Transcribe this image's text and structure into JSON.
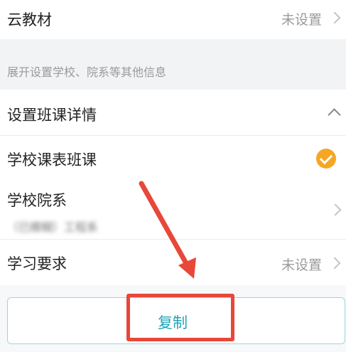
{
  "cloud_textbook": {
    "label": "云教材",
    "value": "未设置"
  },
  "expand_hint": "展开设置学校、院系等其他信息",
  "class_details": {
    "label": "设置班课详情"
  },
  "school_timetable": {
    "label": "学校课表班课",
    "checked": true
  },
  "school_dept": {
    "label": "学校院系",
    "value": "（已模糊）工程系"
  },
  "study_requirements": {
    "label": "学习要求",
    "value": "未设置"
  },
  "copy_button": {
    "label": "复制"
  },
  "colors": {
    "accent": "#1fa5b8",
    "check": "#f5a623",
    "annotation": "#e8473a"
  }
}
